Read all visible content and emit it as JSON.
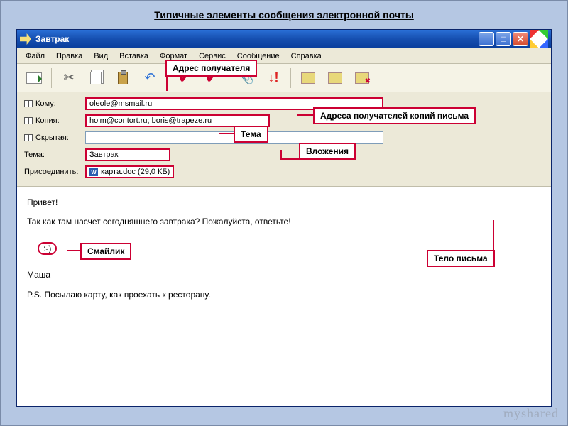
{
  "caption": "Типичные элементы сообщения электронной почты",
  "window": {
    "title": "Завтрак"
  },
  "win_controls": {
    "min": "_",
    "max": "□",
    "close": "✕"
  },
  "menu": {
    "file": "Файл",
    "edit": "Правка",
    "view": "Вид",
    "insert": "Вставка",
    "format": "Формат",
    "tools": "Сервис",
    "message": "Сообщение",
    "help": "Справка"
  },
  "toolbar_icons": {
    "send": "send-icon",
    "cut": "✂",
    "copy": "copy-icon",
    "paste": "paste-icon",
    "undo": "↶",
    "check": "✔",
    "spell": "✔",
    "attach": "📎",
    "priority": "↓!",
    "sign": "x1",
    "encrypt": "x2",
    "offline": "x3"
  },
  "headers": {
    "to_label": "Кому:",
    "to_value": "oleole@msmail.ru",
    "cc_label": "Копия:",
    "cc_value": "holm@contort.ru; boris@trapeze.ru",
    "bcc_label": "Скрытая:",
    "bcc_value": "",
    "subject_label": "Тема:",
    "subject_value": "Завтрак",
    "attach_label": "Присоединить:",
    "attach_value": "карта.doc (29,0 КБ)"
  },
  "body": {
    "greeting": "Привет!",
    "line1": "Так как там насчет сегодняшнего завтрака? Пожалуйста, ответьте!",
    "smiley": ":-)",
    "signature": "Маша",
    "ps": "P.S. Посылаю карту, как проехать к ресторану."
  },
  "callouts": {
    "recipient_addr": "Адрес получателя",
    "cc_addrs": "Адреса получателей копий письма",
    "subject": "Тема",
    "attachments": "Вложения",
    "smiley": "Смайлик",
    "body": "Тело письма"
  },
  "watermark": "myshared"
}
